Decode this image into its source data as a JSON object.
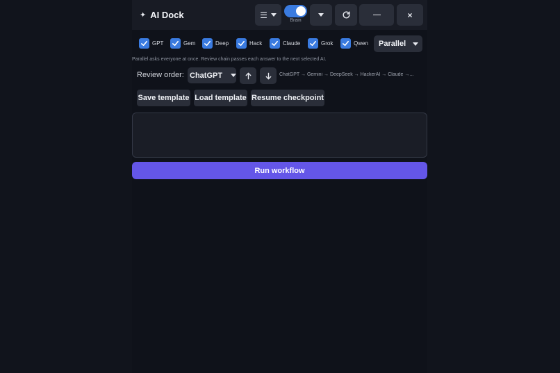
{
  "app": {
    "title": "AI Dock",
    "logo_glyph": "✦"
  },
  "header": {
    "menu_icon": "menu-icon",
    "toggle_label": "Brain",
    "toggle_on": true,
    "min_glyph": "—",
    "close_glyph": "×"
  },
  "models": [
    {
      "label": "GPT",
      "checked": true
    },
    {
      "label": "Gem",
      "checked": true
    },
    {
      "label": "Deep",
      "checked": true
    },
    {
      "label": "Hack",
      "checked": true
    },
    {
      "label": "Claude",
      "checked": true
    },
    {
      "label": "Grok",
      "checked": true
    },
    {
      "label": "Qwen",
      "checked": true
    }
  ],
  "mode": {
    "value": "Parallel"
  },
  "hint": "Parallel asks everyone at once. Review chain passes each answer to the next selected AI.",
  "review": {
    "label": "Review order:",
    "selected": "ChatGPT",
    "chain": "ChatGPT → Gemini → DeepSeek → HackerAI → Claude →..."
  },
  "templates": {
    "save_label": "Save template",
    "load_label": "Load template",
    "resume_label": "Resume checkpoint"
  },
  "prompt": {
    "value": "",
    "placeholder": ""
  },
  "run": {
    "label": "Run workflow"
  },
  "colors": {
    "accent": "#3a7be0",
    "run_button": "#6456e8",
    "background": "#11141c"
  }
}
